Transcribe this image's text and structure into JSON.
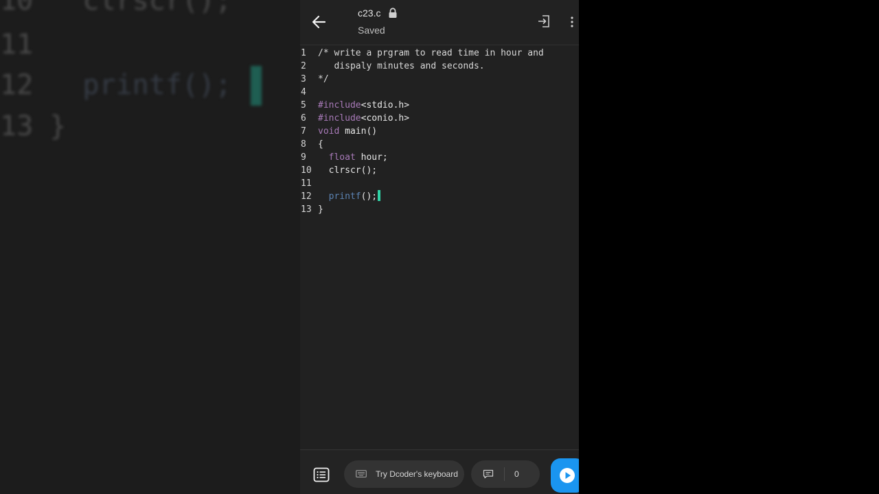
{
  "header": {
    "file_name": "c23.c",
    "save_status": "Saved"
  },
  "editor": {
    "lines": [
      {
        "num": "1",
        "parts": [
          {
            "t": "/* write a prgram to read time in hour and",
            "c": "cmt"
          }
        ]
      },
      {
        "num": "2",
        "parts": [
          {
            "t": "   dispaly minutes and seconds.",
            "c": "cmt"
          }
        ]
      },
      {
        "num": "3",
        "parts": [
          {
            "t": "*/",
            "c": "cmt"
          }
        ]
      },
      {
        "num": "4",
        "parts": []
      },
      {
        "num": "5",
        "parts": [
          {
            "t": "#include",
            "c": "kw"
          },
          {
            "t": "<stdio.h>",
            "c": ""
          }
        ]
      },
      {
        "num": "6",
        "parts": [
          {
            "t": "#include",
            "c": "kw"
          },
          {
            "t": "<conio.h>",
            "c": ""
          }
        ]
      },
      {
        "num": "7",
        "parts": [
          {
            "t": "void",
            "c": "kw"
          },
          {
            "t": " main()",
            "c": ""
          }
        ]
      },
      {
        "num": "8",
        "parts": [
          {
            "t": "{",
            "c": ""
          }
        ]
      },
      {
        "num": "9",
        "parts": [
          {
            "t": "  ",
            "c": ""
          },
          {
            "t": "float",
            "c": "kw"
          },
          {
            "t": " hour;",
            "c": ""
          }
        ]
      },
      {
        "num": "10",
        "parts": [
          {
            "t": "  clrscr();",
            "c": ""
          }
        ]
      },
      {
        "num": "11",
        "parts": []
      },
      {
        "num": "12",
        "parts": [
          {
            "t": "  ",
            "c": ""
          },
          {
            "t": "printf",
            "c": "fn"
          },
          {
            "t": "();",
            "c": ""
          }
        ],
        "cursor": true
      },
      {
        "num": "13",
        "parts": [
          {
            "t": "}",
            "c": ""
          }
        ]
      }
    ]
  },
  "bottombar": {
    "keyboard_label": "Try Dcoder's keyboard",
    "comment_count": "0"
  },
  "backdrop": {
    "lines": [
      {
        "num": "10",
        "code": "   clrscr();"
      },
      {
        "num": "11",
        "code": ""
      },
      {
        "num": "12",
        "code": "   printf();"
      },
      {
        "num": "13",
        "code": " }"
      }
    ]
  },
  "colors": {
    "accent": "#1a95f0",
    "cursor": "#2fd3a6",
    "keyword": "#a87ab8",
    "function": "#5c84b4",
    "editor_bg": "#212121"
  },
  "icons": {
    "back": "arrow-left-icon",
    "lock": "lock-icon",
    "exit": "exit-icon",
    "more": "more-vertical-icon",
    "menu": "list-menu-icon",
    "keyboard": "keyboard-icon",
    "comment": "comment-icon",
    "run": "play-icon"
  }
}
